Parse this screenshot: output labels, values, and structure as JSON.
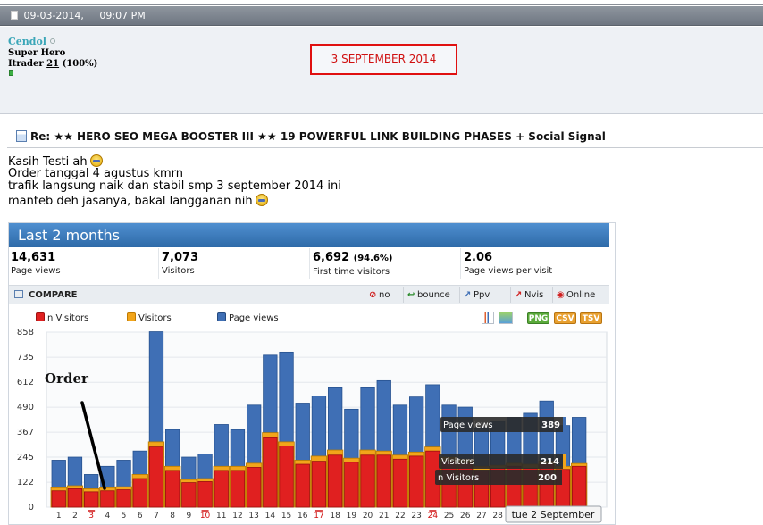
{
  "post": {
    "datetime": "09-03-2014,     09:07 PM",
    "username": "Cendol",
    "user_title": "Super Hero",
    "itrader_label": "Itrader",
    "itrader_score": "21",
    "itrader_pct": "(100%)",
    "date_annotation": "3 SEPTEMBER 2014",
    "thread_title": "Re: ★★ HERO SEO MEGA BOOSTER III ★★ 19 POWERFUL LINK BUILDING PHASES + Social Signal",
    "lines": [
      "Kasih Testi ah",
      "Order tanggal 4 agustus kmrn",
      "trafik langsung naik dan stabil smp 3 september 2014 ini",
      "manteb deh jasanya, bakal langganan nih"
    ]
  },
  "widget": {
    "title": "Last 2 months",
    "stats": [
      {
        "value": "14,631",
        "extra": "",
        "label": "Page views"
      },
      {
        "value": "7,073",
        "extra": "",
        "label": "Visitors"
      },
      {
        "value": "6,692",
        "extra": "(94.6%)",
        "label": "First time visitors"
      },
      {
        "value": "2.06",
        "extra": "",
        "label": "Page views per visit"
      }
    ],
    "compare_label": "COMPARE",
    "compare_buttons": [
      {
        "label": "no",
        "icon": "no-icon"
      },
      {
        "label": "bounce",
        "icon": "bounce-icon"
      },
      {
        "label": "Ppv",
        "icon": "ppv-icon"
      },
      {
        "label": "Nvis",
        "icon": "nvis-icon"
      },
      {
        "label": "Online",
        "icon": "online-icon"
      }
    ],
    "legend": [
      "n Visitors",
      "Visitors",
      "Page views"
    ],
    "export_buttons": [
      "PNG",
      "CSV",
      "TSV"
    ],
    "annotation": "Order",
    "tooltip": {
      "page_views_label": "Page views",
      "page_views_value": "389",
      "visitors_label": "Visitors",
      "visitors_value": "214",
      "nvisitors_label": "n Visitors",
      "nvisitors_value": "200",
      "date_label": "tue 2 September"
    },
    "colors": {
      "header": "#3a78b8",
      "page_views": "#3f6fb5",
      "visitors": "#f2a51a",
      "n_visitors": "#e02020"
    }
  },
  "chart_data": {
    "type": "bar",
    "title": "Last 2 months",
    "yticks": [
      0,
      122,
      245,
      367,
      490,
      612,
      735,
      858
    ],
    "ylim": [
      0,
      858
    ],
    "x_tick_labels": [
      "1",
      "2",
      "3",
      "4",
      "5",
      "6",
      "7",
      "8",
      "9",
      "10",
      "11",
      "12",
      "13",
      "14",
      "15",
      "16",
      "17",
      "18",
      "19",
      "20",
      "21",
      "22",
      "23",
      "24",
      "25",
      "26",
      "27",
      "28"
    ],
    "highlighted_ticks": [
      "3",
      "10",
      "17",
      "24"
    ],
    "series": [
      {
        "name": "Page views",
        "values": [
          230,
          245,
          160,
          200,
          230,
          275,
          860,
          380,
          245,
          260,
          405,
          380,
          500,
          745,
          760,
          510,
          545,
          585,
          480,
          585,
          620,
          500,
          540,
          600,
          500,
          490,
          390,
          420,
          440,
          460,
          520,
          400,
          440
        ]
      },
      {
        "name": "Visitors",
        "values": [
          95,
          105,
          90,
          95,
          100,
          160,
          320,
          200,
          135,
          140,
          200,
          200,
          215,
          365,
          320,
          230,
          250,
          280,
          240,
          280,
          275,
          255,
          270,
          295,
          245,
          235,
          200,
          205,
          215,
          210,
          225,
          200,
          214
        ]
      },
      {
        "name": "n Visitors",
        "values": [
          80,
          90,
          75,
          80,
          85,
          140,
          295,
          180,
          120,
          125,
          180,
          180,
          195,
          340,
          300,
          210,
          225,
          255,
          220,
          255,
          255,
          235,
          250,
          275,
          225,
          215,
          180,
          190,
          200,
          190,
          210,
          185,
          200
        ]
      }
    ]
  }
}
